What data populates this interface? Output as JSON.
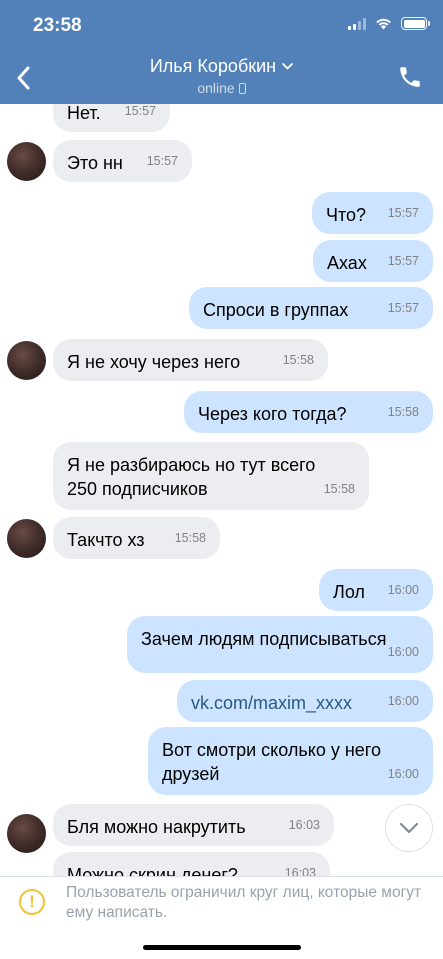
{
  "status_bar": {
    "time": "23:58"
  },
  "header": {
    "contact_name": "Илья Коробкин",
    "status": "online",
    "back_icon": "chevron-left-icon",
    "call_icon": "phone-icon",
    "accent_color": "#5181b8"
  },
  "messages": [
    {
      "dir": "in",
      "text": "Нет.",
      "time": "15:57",
      "avatar": false
    },
    {
      "dir": "in",
      "text": "Это нн",
      "time": "15:57",
      "avatar": true
    },
    {
      "dir": "out",
      "text": "Что?",
      "time": "15:57"
    },
    {
      "dir": "out",
      "text": "Ахах",
      "time": "15:57"
    },
    {
      "dir": "out",
      "text": "Спроси в группах",
      "time": "15:57"
    },
    {
      "dir": "in",
      "text": "Я не хочу через него",
      "time": "15:58",
      "avatar": true
    },
    {
      "dir": "out",
      "text": "Через кого тогда?",
      "time": "15:58"
    },
    {
      "dir": "in",
      "text": "Я не разбираюсь но тут всего\n250 подписчиков",
      "time": "15:58",
      "avatar": false
    },
    {
      "dir": "in",
      "text": "Такчто хз",
      "time": "15:58",
      "avatar": true
    },
    {
      "dir": "out",
      "text": "Лол",
      "time": "16:00"
    },
    {
      "dir": "out",
      "text": "Зачем людям подписываться",
      "time": "16:00"
    },
    {
      "dir": "out",
      "text": "vk.com/maxim_xxxx",
      "time": "16:00",
      "link": true
    },
    {
      "dir": "out",
      "text": "Вот смотри сколько у него\nдрузей",
      "time": "16:00"
    },
    {
      "dir": "in",
      "text": "Бля можно накрутить",
      "time": "16:03",
      "avatar": true
    },
    {
      "dir": "in",
      "text": "Можно скрин денег?",
      "time": "16:03",
      "avatar": false
    }
  ],
  "scroll_down_icon": "chevron-down-icon",
  "footer": {
    "warning_icon": "exclamation-circle-icon",
    "notice": "Пользователь ограничил круг лиц, которые могут ему написать."
  },
  "colors": {
    "incoming_bubble": "#ebedf0",
    "outgoing_bubble": "#cce4ff",
    "warning": "#f0c238"
  }
}
